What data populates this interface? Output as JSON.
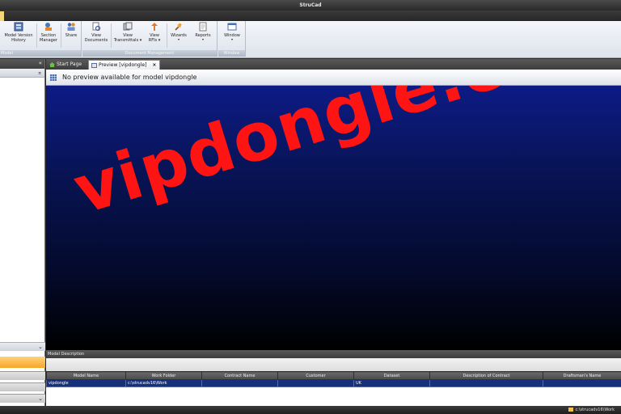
{
  "window": {
    "title": "StruCad"
  },
  "ribbon": {
    "groups": [
      {
        "label": "Model"
      },
      {
        "label": "Document Management"
      },
      {
        "label": "Window"
      }
    ],
    "buttons": {
      "model_version_history": {
        "line1": "Model Version",
        "line2": "History"
      },
      "section_manager": {
        "line1": "Section",
        "line2": "Manager"
      },
      "share": {
        "line1": "Share"
      },
      "view_documents": {
        "line1": "View",
        "line2": "Documents"
      },
      "view_transmittals": {
        "line1": "View",
        "line2": "Transmittals ▾"
      },
      "view_rfis": {
        "line1": "View",
        "line2": "RFIs ▾"
      },
      "wizards": {
        "line1": "Wizards",
        "arrow": "▾"
      },
      "reports": {
        "line1": "Reports",
        "arrow": "▾"
      },
      "window": {
        "line1": "Window",
        "arrow": "▾"
      }
    }
  },
  "left_pane": {
    "collapse": "«",
    "scroll_up": "⌅",
    "scroll_down": "⌄"
  },
  "doc_tabs": {
    "start_page": "Start Page",
    "preview": "Preview [vipdongle]",
    "close": "×"
  },
  "preview": {
    "message": "No preview available for model vipdongle",
    "watermark": "vipdongle.com"
  },
  "model_description": {
    "title": "Model Description",
    "columns": [
      "Model Name",
      "Work Folder",
      "Contract Name",
      "Customer",
      "Dataset",
      "Description of Contract",
      "Draftsman's Name"
    ],
    "rows": [
      [
        "vipdongle",
        "c:\\strucadv16\\Work",
        "",
        "",
        "UK",
        "",
        ""
      ]
    ]
  },
  "statusbar": {
    "path": "c:\\strucadv16\\Work"
  },
  "colors": {
    "accent": "#f7a62a",
    "preview_top": "#0d1b86",
    "watermark": "#ff1414",
    "selected_row": "#16307a"
  }
}
